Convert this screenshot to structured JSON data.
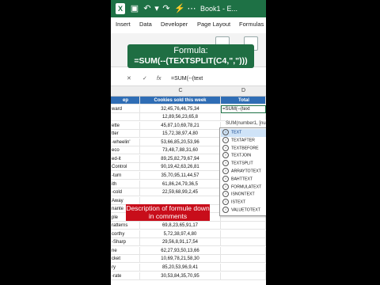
{
  "window": {
    "title": "Book1 - E..."
  },
  "ribbon": {
    "tabs": [
      "Insert",
      "Data",
      "Developer",
      "Page Layout",
      "Formulas"
    ]
  },
  "callout": {
    "line1": "Formula:",
    "line2": "=SUM(--(TEXTSPLIT(C4,\",\")))"
  },
  "formula_bar": {
    "content": "=SUM(--(text"
  },
  "sheet": {
    "columns": [
      "C",
      "D"
    ],
    "header": {
      "a": "ep",
      "c": "Cookies sold this week",
      "d": "Total"
    },
    "rows": [
      {
        "a": "ward",
        "c": "32,45,76,46,75,34",
        "d": "=SUM(--(text"
      },
      {
        "a": "",
        "c": "12,89,56,23,65,8",
        "d": ""
      },
      {
        "a": "ette",
        "c": "45,87,10,69,78,21",
        "d": ""
      },
      {
        "a": "tter",
        "c": "15,72,38,97,4,80",
        "d": ""
      },
      {
        "a": "-wheelin'",
        "c": "53,66,85,20,53,96",
        "d": ""
      },
      {
        "a": "eco",
        "c": "73,48,7,88,31,60",
        "d": ""
      },
      {
        "a": "ed-it",
        "c": "89,25,82,79,67,94",
        "d": ""
      },
      {
        "a": "Control",
        "c": "90,19,42,63,26,81",
        "d": ""
      },
      {
        "a": "-turn",
        "c": "35,70,95,11,44,57",
        "d": ""
      },
      {
        "a": "ith",
        "c": "61,86,24,79,36,5",
        "d": ""
      },
      {
        "a": "-cold",
        "c": "22,59,68,99,2,45",
        "d": ""
      },
      {
        "a": "Away",
        "c": "",
        "d": ""
      },
      {
        "a": "nante",
        "c": "",
        "d": ""
      },
      {
        "a": "ple",
        "c": "",
        "d": ""
      },
      {
        "a": "ratterns",
        "c": "69,8,23,65,91,17",
        "d": ""
      },
      {
        "a": "corthy",
        "c": "5,72,38,97,4,80",
        "d": ""
      },
      {
        "a": "-Sharp",
        "c": "29,56,8,91,17,54",
        "d": ""
      },
      {
        "a": "ne",
        "c": "62,27,93,50,13,66",
        "d": ""
      },
      {
        "a": "cket",
        "c": "10,69,78,21,58,30",
        "d": ""
      },
      {
        "a": "ry",
        "c": "85,20,53,96,9,41",
        "d": ""
      },
      {
        "a": "-rate",
        "c": "30,53,84,35,70,95",
        "d": ""
      }
    ]
  },
  "autocomplete": {
    "hint": "SUM(number1, [number2], ...)",
    "items": [
      "TEXT",
      "TEXTAFTER",
      "TEXTBEFORE",
      "TEXTJOIN",
      "TEXTSPLIT",
      "ARRAYTOTEXT",
      "BAHTTEXT",
      "FORMULATEXT",
      "ISNONTEXT",
      "ISTEXT",
      "VALUETOTEXT"
    ],
    "selected": "TEXT"
  },
  "badge": {
    "text": "Description of formule down in comments"
  },
  "colors": {
    "excel_green": "#1e7145",
    "header_blue": "#2f6db5",
    "badge_red": "#c80d1a"
  }
}
